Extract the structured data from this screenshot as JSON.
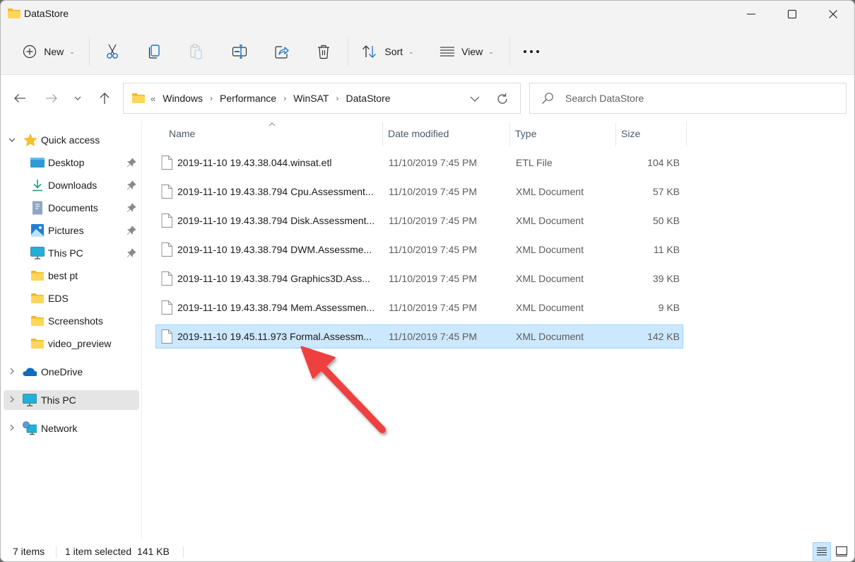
{
  "window": {
    "title": "DataStore",
    "controls": {
      "minimize": "Minimize",
      "maximize": "Maximize",
      "close": "Close"
    }
  },
  "commandbar": {
    "new_label": "New",
    "cut": "Cut",
    "copy": "Copy",
    "paste": "Paste",
    "rename": "Rename",
    "share": "Share",
    "delete": "Delete",
    "sort_label": "Sort",
    "view_label": "View",
    "more": "See more"
  },
  "navigation": {
    "back": "Back",
    "forward": "Forward",
    "recent": "Recent locations",
    "up": "Up",
    "overflow": "«",
    "breadcrumbs": [
      "Windows",
      "Performance",
      "WinSAT",
      "DataStore"
    ],
    "search_placeholder": "Search DataStore",
    "search_value": ""
  },
  "sidebar": {
    "quick_access": {
      "label": "Quick access",
      "expanded": true,
      "items": [
        {
          "label": "Desktop",
          "icon": "desktop-icon",
          "pinned": true
        },
        {
          "label": "Downloads",
          "icon": "downloads-icon",
          "pinned": true
        },
        {
          "label": "Documents",
          "icon": "documents-icon",
          "pinned": true
        },
        {
          "label": "Pictures",
          "icon": "pictures-icon",
          "pinned": true
        },
        {
          "label": "This PC",
          "icon": "this-pc-icon",
          "pinned": true
        },
        {
          "label": "best pt",
          "icon": "folder-icon",
          "pinned": false
        },
        {
          "label": "EDS",
          "icon": "folder-icon",
          "pinned": false
        },
        {
          "label": "Screenshots",
          "icon": "folder-icon",
          "pinned": false
        },
        {
          "label": "video_preview",
          "icon": "folder-icon",
          "pinned": false
        }
      ]
    },
    "roots": [
      {
        "label": "OneDrive",
        "icon": "onedrive-icon",
        "selected": false
      },
      {
        "label": "This PC",
        "icon": "this-pc-icon",
        "selected": true
      },
      {
        "label": "Network",
        "icon": "network-icon",
        "selected": false
      }
    ]
  },
  "filelist": {
    "columns": {
      "name": "Name",
      "date": "Date modified",
      "type": "Type",
      "size": "Size"
    },
    "sort_column": "name",
    "rows": [
      {
        "name": "2019-11-10 19.43.38.044.winsat.etl",
        "date": "11/10/2019 7:45 PM",
        "type": "ETL File",
        "size": "104 KB",
        "selected": false
      },
      {
        "name": "2019-11-10 19.43.38.794 Cpu.Assessment...",
        "date": "11/10/2019 7:45 PM",
        "type": "XML Document",
        "size": "57 KB",
        "selected": false
      },
      {
        "name": "2019-11-10 19.43.38.794 Disk.Assessment...",
        "date": "11/10/2019 7:45 PM",
        "type": "XML Document",
        "size": "50 KB",
        "selected": false
      },
      {
        "name": "2019-11-10 19.43.38.794 DWM.Assessme...",
        "date": "11/10/2019 7:45 PM",
        "type": "XML Document",
        "size": "11 KB",
        "selected": false
      },
      {
        "name": "2019-11-10 19.43.38.794 Graphics3D.Ass...",
        "date": "11/10/2019 7:45 PM",
        "type": "XML Document",
        "size": "39 KB",
        "selected": false
      },
      {
        "name": "2019-11-10 19.43.38.794 Mem.Assessmen...",
        "date": "11/10/2019 7:45 PM",
        "type": "XML Document",
        "size": "9 KB",
        "selected": false
      },
      {
        "name": "2019-11-10 19.45.11.973 Formal.Assessm...",
        "date": "11/10/2019 7:45 PM",
        "type": "XML Document",
        "size": "142 KB",
        "selected": true
      }
    ]
  },
  "statusbar": {
    "item_count": "7 items",
    "selection": "1 item selected  141 KB",
    "details_view": "Details",
    "preview_view": "Large icons"
  },
  "annotation": {
    "type": "arrow",
    "color": "#e84040",
    "points_to": "2019-11-10 19.45.11.973 Formal.Assessm..."
  },
  "colors": {
    "selection_bg": "#cce8ff",
    "selection_border": "#99d1ff",
    "accent": "#0067c0",
    "folder": "#f8cf55"
  }
}
